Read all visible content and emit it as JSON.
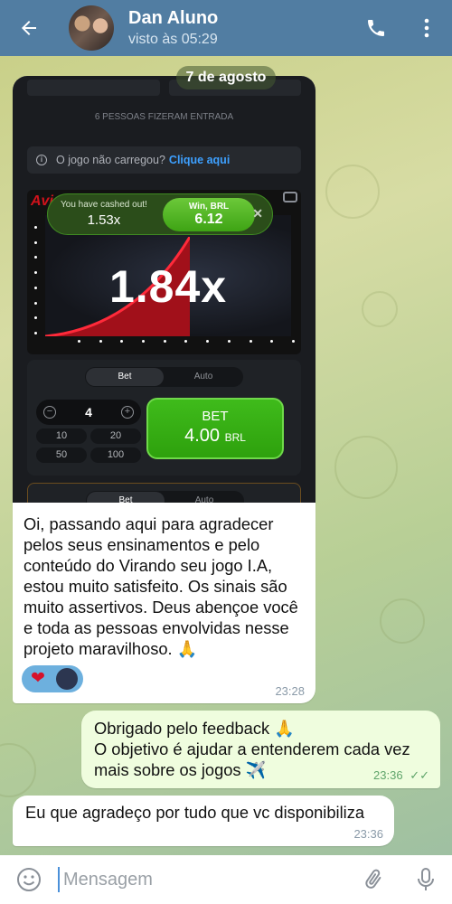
{
  "header": {
    "name": "Dan Aluno",
    "status": "visto às 05:29"
  },
  "date_pill": "7 de agosto",
  "screenshot": {
    "entered_label": "6 PESSOAS FIZERAM ENTRADA",
    "load_prompt": "O jogo não carregou?",
    "load_link": "Clique aqui",
    "logo_text": "Avi",
    "cashout_label": "You have cashed out!",
    "cashout_value": "1.53x",
    "win_label": "Win, BRL",
    "win_value": "6.12",
    "multiplier": "1.84x",
    "tab_bet": "Bet",
    "tab_auto": "Auto",
    "stake": "4",
    "quick_amounts": [
      "10",
      "20",
      "50",
      "100"
    ],
    "bet_label": "BET",
    "bet_amount": "4.00",
    "bet_currency": "BRL",
    "tab_bet2": "Bet",
    "tab_auto2": "Auto"
  },
  "messages": {
    "incoming_1": {
      "text": "Oi, passando aqui para agradecer pelos seus ensinamentos e pelo conteúdo do Virando seu jogo I.A, estou muito satisfeito. Os sinais são muito assertivos. Deus abençoe você e toda as pessoas envolvidas nesse projeto maravilhoso. 🙏",
      "reaction": "❤",
      "time": "23:28"
    },
    "outgoing_1": {
      "line1": "Obrigado pelo feedback 🙏",
      "line2": "O objetivo é ajudar a entenderem cada vez mais sobre os jogos ✈️",
      "time": "23:36"
    },
    "incoming_2": {
      "text": "Eu que agradeço por tudo que vc disponibiliza",
      "time": "23:36"
    }
  },
  "input": {
    "placeholder": "Mensagem"
  }
}
